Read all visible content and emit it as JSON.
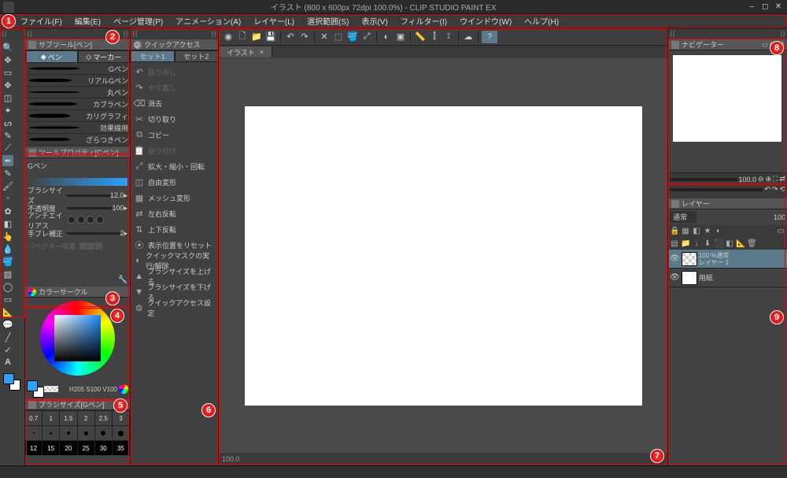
{
  "titlebar": {
    "title": "イラスト (800 x 600px 72dpi 100.0%)   -  CLIP STUDIO PAINT EX"
  },
  "menu": [
    "ファイル(F)",
    "編集(E)",
    "ページ管理(P)",
    "アニメーション(A)",
    "レイヤー(L)",
    "選択範囲(S)",
    "表示(V)",
    "フィルター(I)",
    "ウインドウ(W)",
    "ヘルプ(H)"
  ],
  "badges": [
    "1",
    "2",
    "3",
    "4",
    "5",
    "6",
    "7",
    "8",
    "9"
  ],
  "subtool": {
    "tab": "サブツール[ペン]",
    "sub1": "ペン",
    "sub2": "マーカー",
    "pens": [
      "Gペン",
      "リアルGペン",
      "丸ペン",
      "カブラペン",
      "カリグラフィ",
      "効果線用",
      "ざらつきペン"
    ]
  },
  "toolprop": {
    "tab": "ツールプロパティ[Gペン]",
    "title": "Gペン",
    "brushsize_lbl": "ブラシサイズ",
    "brushsize_val": "12.0",
    "opacity_lbl": "不透明度",
    "opacity_val": "100",
    "aa_lbl": "アンチエイリアス",
    "stab_lbl": "手ブレ補正",
    "stab_val": "2",
    "vec_lbl": "ベクター吸着"
  },
  "color": {
    "tab": "カラーサークル",
    "val1": "205",
    "val2": "100",
    "val3": "100"
  },
  "brushsize_panel": {
    "tab": "ブラシサイズ[Gペン]",
    "row1": [
      "0.7",
      "1",
      "1.5",
      "2",
      "2.5",
      "3"
    ],
    "row3": [
      "12",
      "15",
      "20",
      "25",
      "30",
      "35"
    ]
  },
  "quickaccess": {
    "tab": "クイックアクセス",
    "set1": "セット1",
    "set2": "セット2",
    "items": [
      {
        "icon": "↶",
        "label": "取り消し",
        "dim": true
      },
      {
        "icon": "↷",
        "label": "やり直し",
        "dim": true
      },
      {
        "icon": "⌫",
        "label": "消去"
      },
      {
        "icon": "✂",
        "label": "切り取り"
      },
      {
        "icon": "⧉",
        "label": "コピー"
      },
      {
        "icon": "📋",
        "label": "貼り付け",
        "dim": true
      },
      {
        "icon": "⤢",
        "label": "拡大・縮小・回転"
      },
      {
        "icon": "◫",
        "label": "自由変形"
      },
      {
        "icon": "▦",
        "label": "メッシュ変形"
      },
      {
        "icon": "⇄",
        "label": "左右反転"
      },
      {
        "icon": "⇅",
        "label": "上下反転"
      },
      {
        "icon": "⦿",
        "label": "表示位置をリセット"
      },
      {
        "icon": "◐",
        "label": "クイックマスクの実行/解除"
      },
      {
        "icon": "▲",
        "label": "ブラシサイズを上げる"
      },
      {
        "icon": "▼",
        "label": "ブラシサイズを下げる"
      },
      {
        "icon": "⚙",
        "label": "クイックアクセス設定"
      }
    ]
  },
  "canvas": {
    "tab": "イラスト",
    "zoom": "100.0"
  },
  "navigator": {
    "tab": "ナビゲーター"
  },
  "layer": {
    "tab": "レイヤー",
    "mode": "通常",
    "opacity": "100",
    "l1_meta": "100 %通常",
    "l1_name": "レイヤー 1",
    "paper": "用紙",
    "tool_opacity": "100.0"
  }
}
